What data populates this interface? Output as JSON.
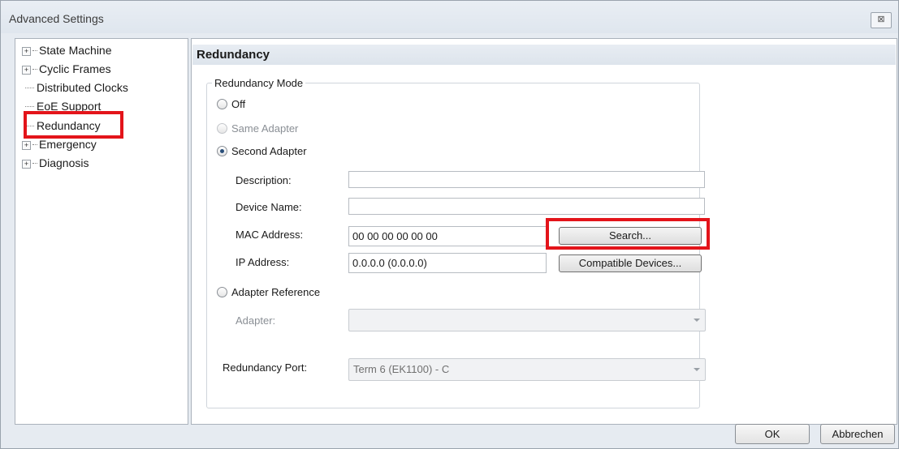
{
  "window": {
    "title": "Advanced Settings",
    "close_glyph": "⊠"
  },
  "tree": {
    "items": [
      {
        "label": "State Machine",
        "expandable": true
      },
      {
        "label": "Cyclic Frames",
        "expandable": true
      },
      {
        "label": "Distributed Clocks",
        "expandable": false
      },
      {
        "label": "EoE Support",
        "expandable": false
      },
      {
        "label": "Redundancy",
        "expandable": false,
        "selected": true
      },
      {
        "label": "Emergency",
        "expandable": true
      },
      {
        "label": "Diagnosis",
        "expandable": true
      }
    ]
  },
  "panel": {
    "title": "Redundancy",
    "group_label": "Redundancy Mode",
    "radio_off": "Off",
    "radio_same_adapter": "Same Adapter",
    "radio_second_adapter": "Second Adapter",
    "radio_adapter_reference": "Adapter Reference",
    "selected_mode": "Second Adapter",
    "fields": {
      "description_label": "Description:",
      "description_value": "",
      "device_name_label": "Device Name:",
      "device_name_value": "",
      "mac_label": "MAC Address:",
      "mac_value": "00 00 00 00 00 00",
      "ip_label": "IP Address:",
      "ip_value": "0.0.0.0 (0.0.0.0)"
    },
    "search_button": "Search...",
    "compatible_button": "Compatible Devices...",
    "adapter_label": "Adapter:",
    "adapter_value": "",
    "redundancy_port_label": "Redundancy Port:",
    "redundancy_port_value": "Term 6 (EK1100) - C"
  },
  "footer": {
    "ok": "OK",
    "cancel": "Abbrechen"
  },
  "colors": {
    "highlight": "#e3141a"
  }
}
